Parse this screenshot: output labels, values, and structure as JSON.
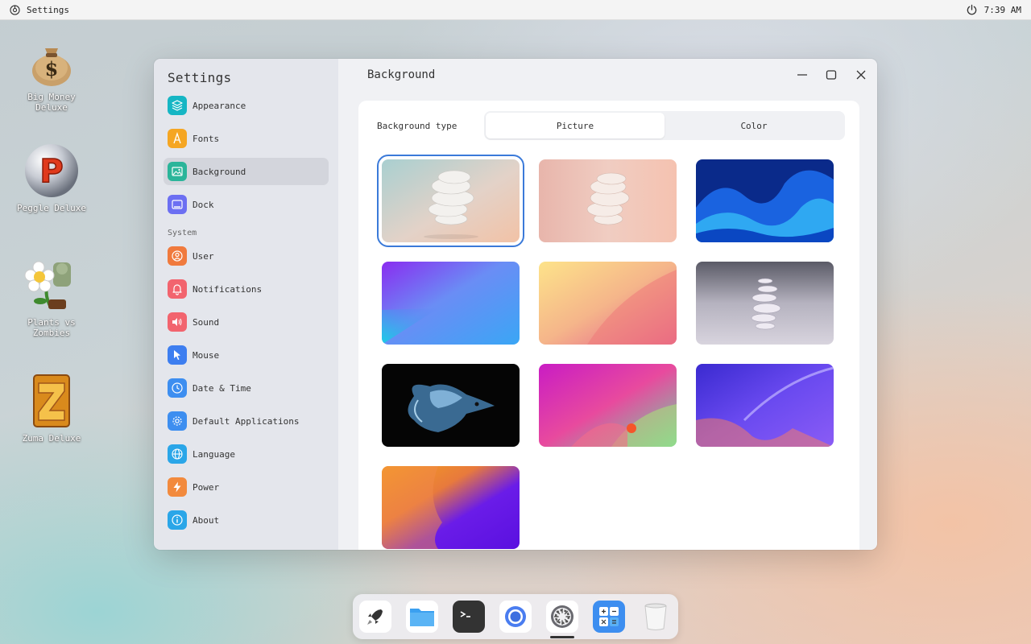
{
  "topbar": {
    "app_name": "Settings",
    "time": "7:39 AM"
  },
  "desktop_icons": [
    {
      "label": "Big Money Deluxe"
    },
    {
      "label": "Peggle Deluxe"
    },
    {
      "label": "Plants vs Zombies"
    },
    {
      "label": "Zuma Deluxe"
    }
  ],
  "sidebar": {
    "title": "Settings",
    "items": [
      {
        "label": "Appearance",
        "color": "#16b6c4"
      },
      {
        "label": "Fonts",
        "color": "#f5a623"
      },
      {
        "label": "Background",
        "color": "#2bb59a"
      },
      {
        "label": "Dock",
        "color": "#6c6ff2"
      }
    ],
    "section_label": "System",
    "system_items": [
      {
        "label": "User",
        "color": "#f07a3d"
      },
      {
        "label": "Notifications",
        "color": "#f2646e"
      },
      {
        "label": "Sound",
        "color": "#f2646e"
      },
      {
        "label": "Mouse",
        "color": "#3d7ef0"
      },
      {
        "label": "Date & Time",
        "color": "#3d8ef0"
      },
      {
        "label": "Default Applications",
        "color": "#3d8ef0"
      },
      {
        "label": "Language",
        "color": "#2aa6e8"
      },
      {
        "label": "Power",
        "color": "#f28a3d"
      },
      {
        "label": "About",
        "color": "#2aa6e8"
      }
    ]
  },
  "main": {
    "title": "Background",
    "background_type_label": "Background type",
    "options": {
      "picture": "Picture",
      "color": "Color"
    },
    "selected_option": "Picture",
    "selected_wallpaper_index": 0,
    "wallpaper_count": 10
  },
  "dock": {
    "apps": [
      "launcher",
      "file-manager",
      "terminal",
      "browser",
      "settings",
      "calculator",
      "trash"
    ],
    "running": "settings"
  }
}
